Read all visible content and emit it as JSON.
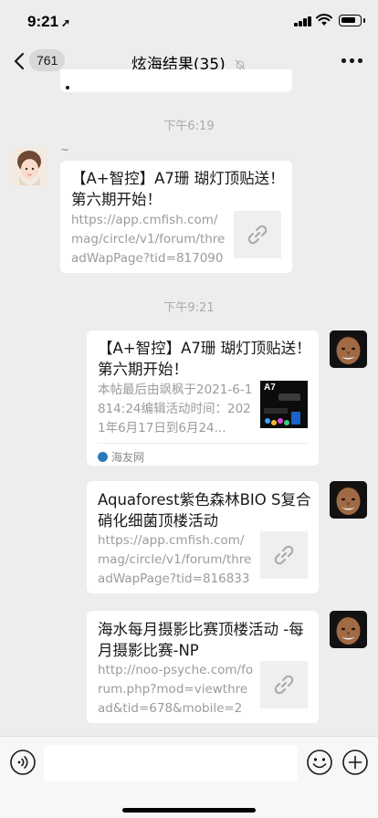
{
  "status_bar": {
    "time": "9:21"
  },
  "nav": {
    "unread_count": "761",
    "title": "炫海结果(35)"
  },
  "chat": {
    "time_labels": [
      "下午6:19",
      "下午9:21"
    ],
    "messages": [
      {
        "sender": "~",
        "title": "【A+智控】A7珊 瑚灯顶贴送！第六期开始！",
        "desc": "https://app.cmfish.com/mag/circle/v1/forum/threadWapPage?tid=817090&..."
      },
      {
        "title": "【A+智控】A7珊 瑚灯顶贴送！第六期开始！",
        "desc": "本帖最后由飒枫于2021-6-1814:24编辑活动时间：2021年6月17日到6月24...",
        "thumb_label": "A7",
        "source": "海友网"
      },
      {
        "title": "Aquaforest紫色森林BIO S复合硝化细菌顶楼活动",
        "desc": "https://app.cmfish.com/mag/circle/v1/forum/threadWapPage?tid=816833&..."
      },
      {
        "title": "海水每月摄影比赛顶楼活动 -每月摄影比赛-NP",
        "desc": "http://noo-psyche.com/forum.php?mod=viewthread&tid=678&mobile=2"
      }
    ]
  }
}
